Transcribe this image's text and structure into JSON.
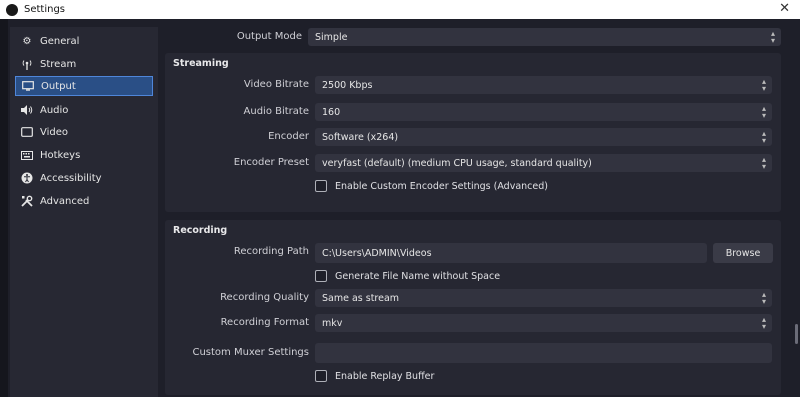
{
  "window": {
    "title": "Settings",
    "close_glyph": "✕"
  },
  "sidebar": {
    "items": [
      {
        "label": "General",
        "icon": "gear-icon",
        "selected": false
      },
      {
        "label": "Stream",
        "icon": "antenna-icon",
        "selected": false
      },
      {
        "label": "Output",
        "icon": "output-icon",
        "selected": true
      },
      {
        "label": "Audio",
        "icon": "speaker-icon",
        "selected": false
      },
      {
        "label": "Video",
        "icon": "monitor-icon",
        "selected": false
      },
      {
        "label": "Hotkeys",
        "icon": "keyboard-icon",
        "selected": false
      },
      {
        "label": "Accessibility",
        "icon": "accessibility-icon",
        "selected": false
      },
      {
        "label": "Advanced",
        "icon": "tools-icon",
        "selected": false
      }
    ]
  },
  "output_mode": {
    "label": "Output Mode",
    "value": "Simple"
  },
  "streaming": {
    "title": "Streaming",
    "video_bitrate": {
      "label": "Video Bitrate",
      "value": "2500 Kbps"
    },
    "audio_bitrate": {
      "label": "Audio Bitrate",
      "value": "160"
    },
    "encoder": {
      "label": "Encoder",
      "value": "Software (x264)"
    },
    "encoder_preset": {
      "label": "Encoder Preset",
      "value": "veryfast (default) (medium CPU usage, standard quality)"
    },
    "custom_encoder": {
      "label": "Enable Custom Encoder Settings (Advanced)",
      "checked": false
    }
  },
  "recording": {
    "title": "Recording",
    "path": {
      "label": "Recording Path",
      "value": "C:\\Users\\ADMIN\\Videos",
      "browse_label": "Browse"
    },
    "no_space": {
      "label": "Generate File Name without Space",
      "checked": false
    },
    "quality": {
      "label": "Recording Quality",
      "value": "Same as stream"
    },
    "format": {
      "label": "Recording Format",
      "value": "mkv"
    },
    "muxer": {
      "label": "Custom Muxer Settings",
      "value": ""
    },
    "replay_buffer": {
      "label": "Enable Replay Buffer",
      "checked": false
    }
  }
}
